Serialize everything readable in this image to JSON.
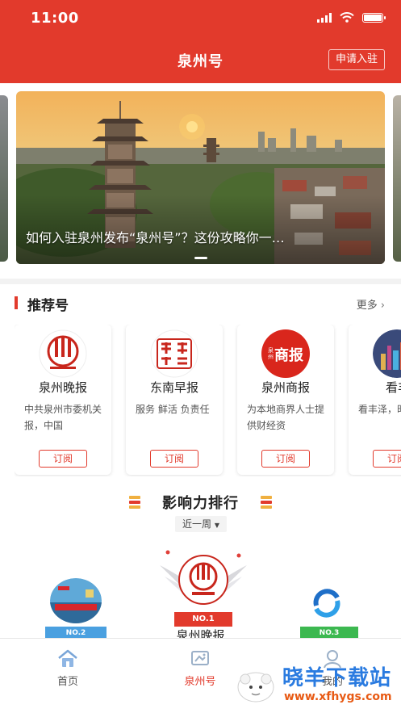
{
  "status_bar": {
    "time": "11:00"
  },
  "header": {
    "title": "泉州号",
    "apply_label": "申请入驻"
  },
  "banner": {
    "title": "如何入驻泉州发布“泉州号”？这份攻略你一…"
  },
  "recommended": {
    "title": "推荐号",
    "more_label": "更多",
    "cards": [
      {
        "name": "泉州晚报",
        "desc": "中共泉州市委机关报，中国",
        "subscribe_label": "订阅"
      },
      {
        "name": "东南早报",
        "desc": "服务 鲜活 负责任",
        "subscribe_label": "订阅"
      },
      {
        "name": "泉州商报",
        "desc": "为本地商界人士提供财经资",
        "subscribe_label": "订阅",
        "logo_text": "商报",
        "logo_small": "泉州"
      },
      {
        "name": "看丰",
        "desc": "看丰泽，时尚都会",
        "subscribe_label": "订阅"
      }
    ]
  },
  "ranking": {
    "title": "影响力排行",
    "period": "近一周",
    "first": {
      "rank": "NO.1",
      "name": "泉州晚报"
    },
    "second": {
      "rank": "NO.2"
    },
    "third": {
      "rank": "NO.3"
    }
  },
  "tabbar": {
    "items": [
      {
        "label": "首页",
        "icon": "home-icon"
      },
      {
        "label": "泉州号",
        "icon": "quanzhou-hao-icon"
      },
      {
        "label": "我的",
        "icon": "profile-icon"
      }
    ]
  },
  "watermark": {
    "text": "晓羊下载站",
    "url": "www.xfhygs.com"
  },
  "colors": {
    "brand_red": "#e23a2c",
    "watermark_blue": "#2a7be0",
    "watermark_orange": "#e85a14"
  }
}
